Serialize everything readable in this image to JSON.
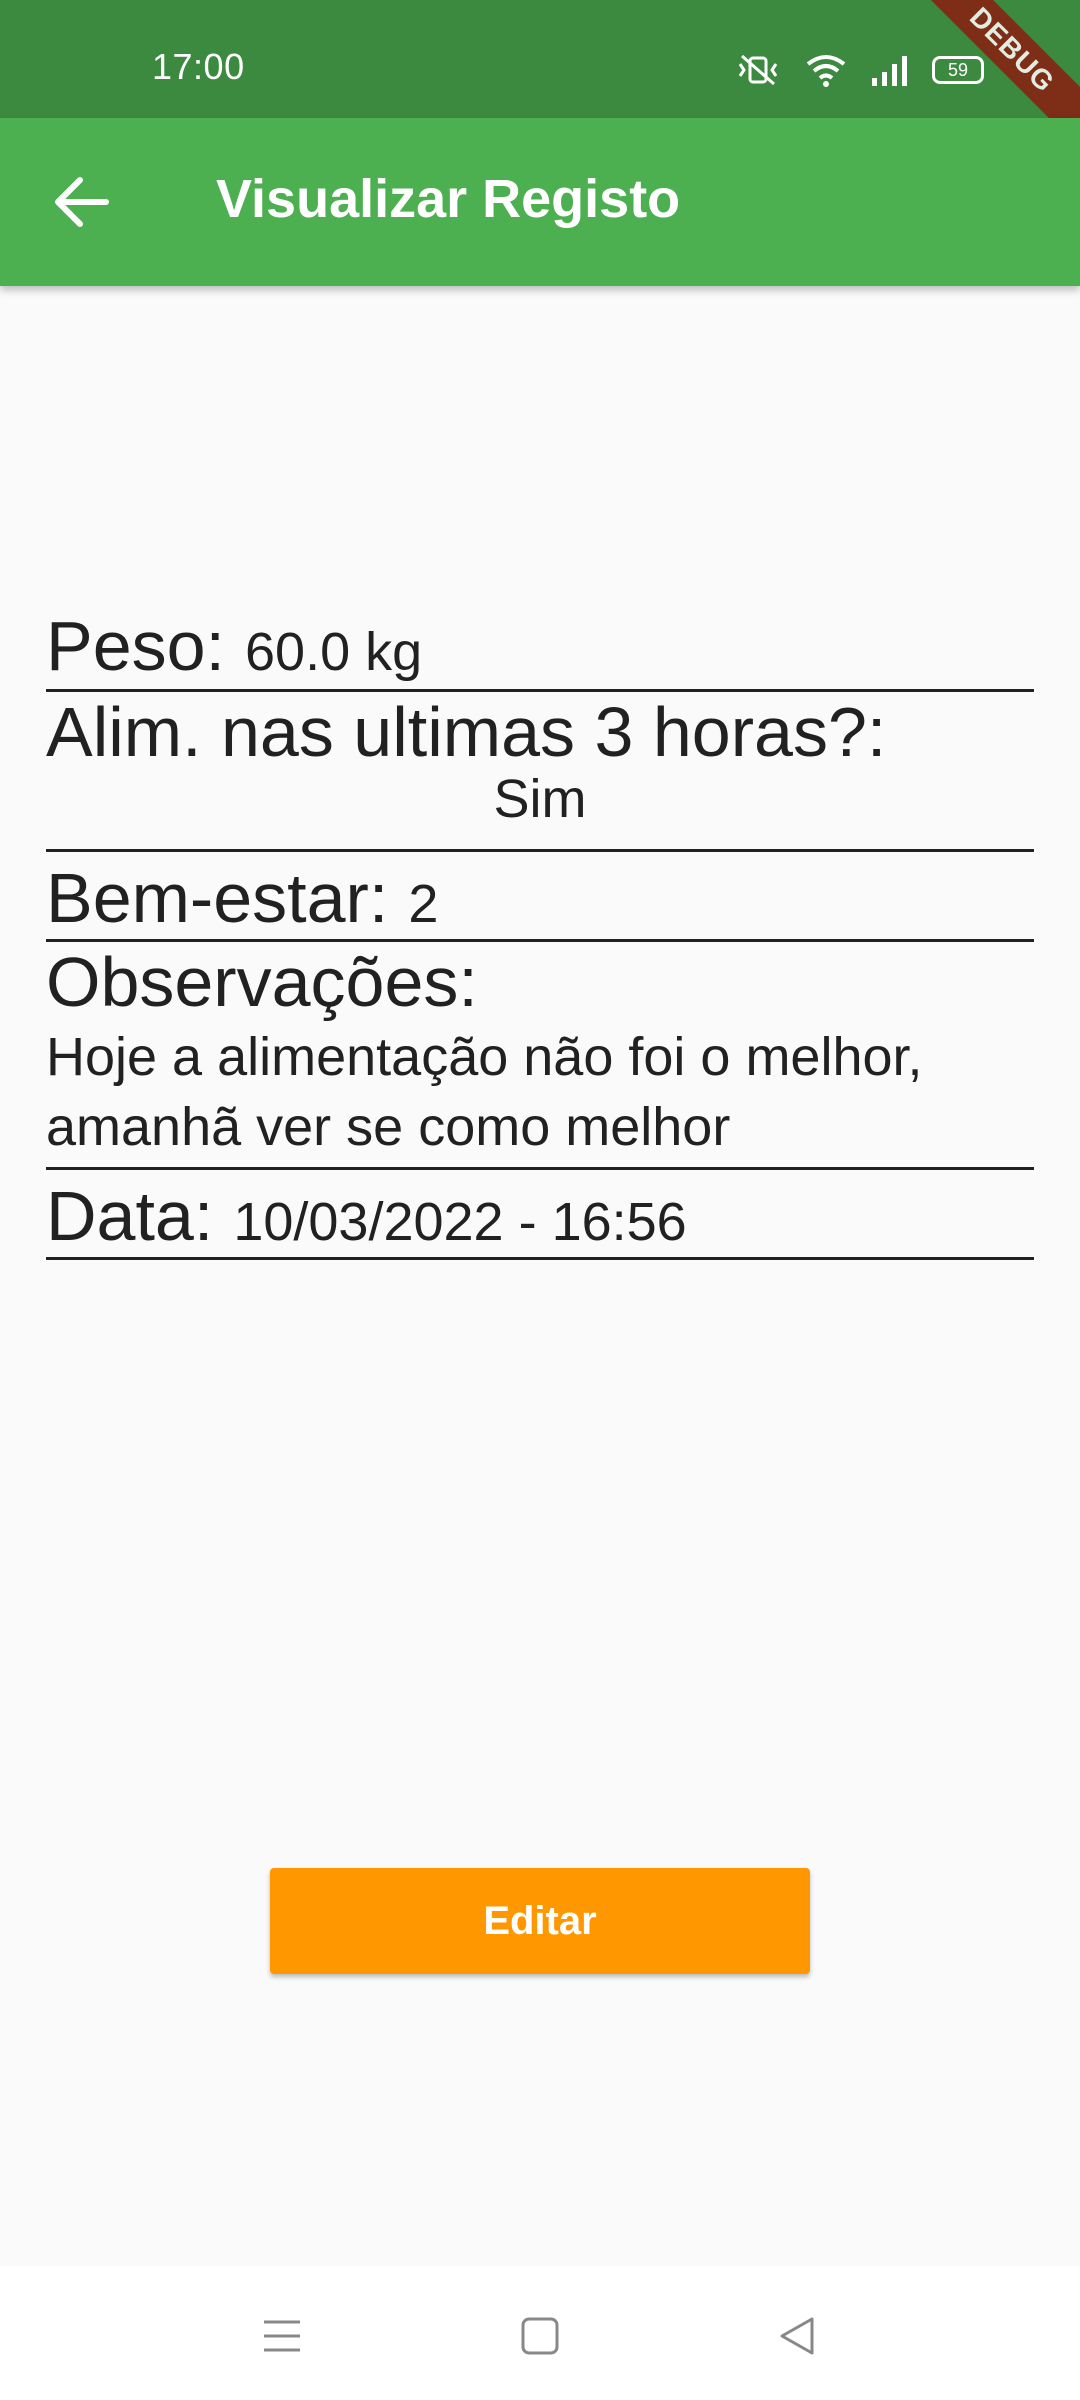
{
  "status_bar": {
    "time": "17:00",
    "battery": "59",
    "icons": [
      "vibrate-mute-icon",
      "wifi-icon",
      "signal-icon",
      "battery-charging-icon"
    ],
    "debug_banner": "DEBUG"
  },
  "app_bar": {
    "title": "Visualizar Registo",
    "back_icon": "arrow-back-icon",
    "color": "#4caf50"
  },
  "record": {
    "peso_label": "Peso:",
    "peso_value": "60.0 kg",
    "alim_label": "Alim. nas ultimas 3 horas?:",
    "alim_value": "Sim",
    "bem_label": "Bem-estar:",
    "bem_value": "2",
    "obs_label": "Observações:",
    "obs_value": "Hoje a alimentação não foi o melhor, amanhã ver se como melhor",
    "data_label": "Data:",
    "data_value": "10/03/2022 - 16:56"
  },
  "actions": {
    "edit_label": "Editar",
    "edit_color": "#ff9800"
  },
  "nav_bar": {
    "icons": [
      "menu-icon",
      "home-square-icon",
      "back-triangle-icon"
    ]
  }
}
